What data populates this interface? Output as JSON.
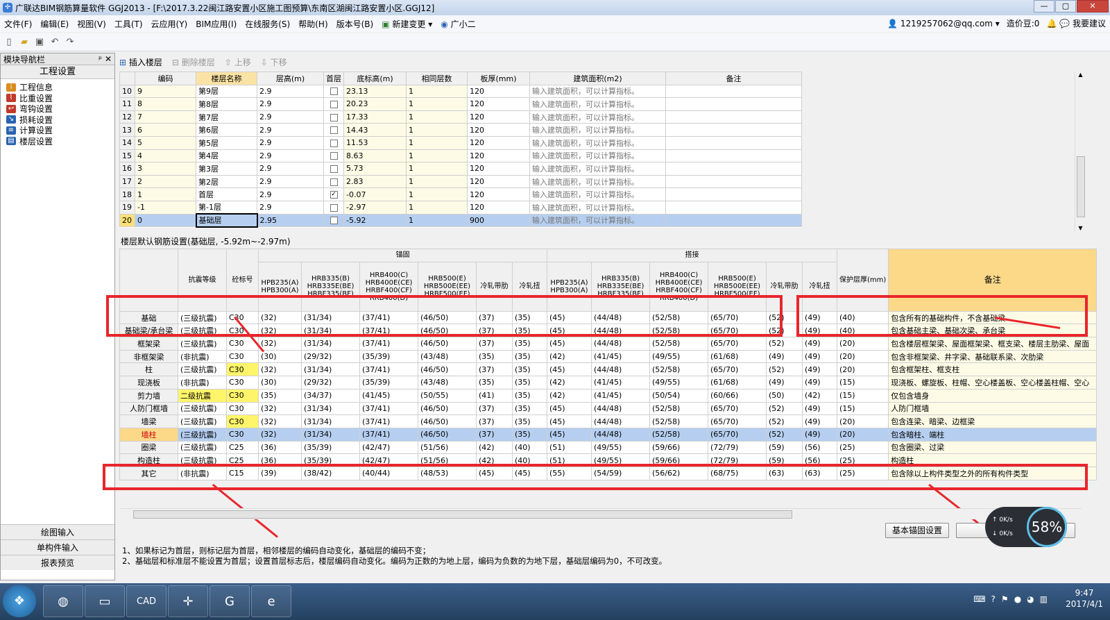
{
  "window": {
    "title": "广联达BIM钢筋算量软件 GGJ2013 - [F:\\2017.3.22闽江路安置小区施工图预算\\东南区湖闽江路安置小区.GGJ12]",
    "app_icon": "app-logo-icon",
    "buttons": {
      "minimize": "—",
      "restore": "▢",
      "close": "✕"
    }
  },
  "menu": {
    "items": [
      "文件(F)",
      "编辑(E)",
      "视图(V)",
      "工具(T)",
      "云应用(Y)",
      "BIM应用(I)",
      "在线服务(S)",
      "帮助(H)",
      "版本号(B)",
      "新建变更",
      "广小二"
    ],
    "account": "1219257062@qq.com",
    "price_beans": "造价豆:0",
    "suggest": "我要建议"
  },
  "nav": {
    "title": "模块导航栏",
    "pin": "ᵖ",
    "close": "✕",
    "section": "工程设置",
    "items": [
      {
        "label": "工程信息",
        "icon": "project-info-icon",
        "color": "#d98c1f"
      },
      {
        "label": "比重设置",
        "icon": "weight-setting-icon",
        "color": "#c0392b"
      },
      {
        "label": "弯钩设置",
        "icon": "hook-setting-icon",
        "color": "#c0392b"
      },
      {
        "label": "损耗设置",
        "icon": "loss-setting-icon",
        "color": "#2a63b0"
      },
      {
        "label": "计算设置",
        "icon": "calc-setting-icon",
        "color": "#2a63b0"
      },
      {
        "label": "楼层设置",
        "icon": "floor-setting-icon",
        "color": "#2a63b0"
      }
    ],
    "bottom": [
      "绘图输入",
      "单构件输入",
      "报表预览"
    ]
  },
  "floor_toolbar": {
    "insert": "插入楼层",
    "delete": "删除楼层",
    "up": "上移",
    "down": "下移"
  },
  "floor_table": {
    "headers": [
      "",
      "编码",
      "楼层名称",
      "层高(m)",
      "首层",
      "底标高(m)",
      "相同层数",
      "板厚(mm)",
      "建筑面积(m2)",
      "备注"
    ],
    "rows": [
      {
        "idx": "10",
        "code": "9",
        "name": "第9层",
        "height": "2.9",
        "first": false,
        "elev": "23.13",
        "same": "1",
        "thick": "120",
        "area": "输入建筑面积，可以计算指标。"
      },
      {
        "idx": "11",
        "code": "8",
        "name": "第8层",
        "height": "2.9",
        "first": false,
        "elev": "20.23",
        "same": "1",
        "thick": "120",
        "area": "输入建筑面积，可以计算指标。"
      },
      {
        "idx": "12",
        "code": "7",
        "name": "第7层",
        "height": "2.9",
        "first": false,
        "elev": "17.33",
        "same": "1",
        "thick": "120",
        "area": "输入建筑面积，可以计算指标。"
      },
      {
        "idx": "13",
        "code": "6",
        "name": "第6层",
        "height": "2.9",
        "first": false,
        "elev": "14.43",
        "same": "1",
        "thick": "120",
        "area": "输入建筑面积，可以计算指标。"
      },
      {
        "idx": "14",
        "code": "5",
        "name": "第5层",
        "height": "2.9",
        "first": false,
        "elev": "11.53",
        "same": "1",
        "thick": "120",
        "area": "输入建筑面积，可以计算指标。"
      },
      {
        "idx": "15",
        "code": "4",
        "name": "第4层",
        "height": "2.9",
        "first": false,
        "elev": "8.63",
        "same": "1",
        "thick": "120",
        "area": "输入建筑面积，可以计算指标。"
      },
      {
        "idx": "16",
        "code": "3",
        "name": "第3层",
        "height": "2.9",
        "first": false,
        "elev": "5.73",
        "same": "1",
        "thick": "120",
        "area": "输入建筑面积，可以计算指标。"
      },
      {
        "idx": "17",
        "code": "2",
        "name": "第2层",
        "height": "2.9",
        "first": false,
        "elev": "2.83",
        "same": "1",
        "thick": "120",
        "area": "输入建筑面积，可以计算指标。"
      },
      {
        "idx": "18",
        "code": "1",
        "name": "首层",
        "height": "2.9",
        "first": true,
        "elev": "-0.07",
        "same": "1",
        "thick": "120",
        "area": "输入建筑面积，可以计算指标。"
      },
      {
        "idx": "19",
        "code": "-1",
        "name": "第-1层",
        "height": "2.9",
        "first": false,
        "elev": "-2.97",
        "same": "1",
        "thick": "120",
        "area": "输入建筑面积，可以计算指标。"
      },
      {
        "idx": "20",
        "code": "0",
        "name": "基础层",
        "height": "2.95",
        "first": false,
        "elev": "-5.92",
        "same": "1",
        "thick": "900",
        "area": "输入建筑面积，可以计算指标。",
        "selected": true
      }
    ]
  },
  "rebar_settings": {
    "title": "楼层默认钢筋设置(基础层, -5.92m~-2.97m)",
    "group_anchor": "锚固",
    "group_lap": "搭接",
    "headers": {
      "seismic": "抗震等级",
      "concrete": "砼标号",
      "hpb": "HPB235(A) HPB300(A)",
      "hrb335": "HRB335(B) HRB335E(BE) HRBF335(BF)",
      "hrb400": "HRB400(C) HRB400E(CE) HRBF400(CF) RRB400(D)",
      "hrb500": "HRB500(E) HRB500E(EE) HRBF500(EF)",
      "cold_ribbed": "冷轧带肋",
      "cold_twisted": "冷轧扭",
      "cover": "保护层厚(mm)",
      "note": "备注"
    },
    "rows": [
      {
        "name": "基础",
        "seismic": "(三级抗震)",
        "concrete": "C30",
        "a1": "(32)",
        "a2": "(31/34)",
        "a3": "(37/41)",
        "a4": "(46/50)",
        "a5": "(37)",
        "a6": "(35)",
        "l1": "(45)",
        "l2": "(44/48)",
        "l3": "(52/58)",
        "l4": "(65/70)",
        "l5": "(52)",
        "l6": "(49)",
        "cover": "(40)",
        "note": "包含所有的基础构件，不含基础梁"
      },
      {
        "name": "基础梁/承台梁",
        "seismic": "(三级抗震)",
        "concrete": "C30",
        "a1": "(32)",
        "a2": "(31/34)",
        "a3": "(37/41)",
        "a4": "(46/50)",
        "a5": "(37)",
        "a6": "(35)",
        "l1": "(45)",
        "l2": "(44/48)",
        "l3": "(52/58)",
        "l4": "(65/70)",
        "l5": "(52)",
        "l6": "(49)",
        "cover": "(40)",
        "note": "包含基础主梁、基础次梁、承台梁"
      },
      {
        "name": "框架梁",
        "seismic": "(三级抗震)",
        "concrete": "C30",
        "a1": "(32)",
        "a2": "(31/34)",
        "a3": "(37/41)",
        "a4": "(46/50)",
        "a5": "(37)",
        "a6": "(35)",
        "l1": "(45)",
        "l2": "(44/48)",
        "l3": "(52/58)",
        "l4": "(65/70)",
        "l5": "(52)",
        "l6": "(49)",
        "cover": "(20)",
        "note": "包含楼层框架梁、屋面框架梁、框支梁、楼层主肋梁、屋面"
      },
      {
        "name": "非框架梁",
        "seismic": "(非抗震)",
        "concrete": "C30",
        "a1": "(30)",
        "a2": "(29/32)",
        "a3": "(35/39)",
        "a4": "(43/48)",
        "a5": "(35)",
        "a6": "(35)",
        "l1": "(42)",
        "l2": "(41/45)",
        "l3": "(49/55)",
        "l4": "(61/68)",
        "l5": "(49)",
        "l6": "(49)",
        "cover": "(20)",
        "note": "包含非框架梁、井字梁、基础联系梁、次肋梁"
      },
      {
        "name": "柱",
        "seismic": "(三级抗震)",
        "concrete": "C30",
        "hlC": true,
        "a1": "(32)",
        "a2": "(31/34)",
        "a3": "(37/41)",
        "a4": "(46/50)",
        "a5": "(37)",
        "a6": "(35)",
        "l1": "(45)",
        "l2": "(44/48)",
        "l3": "(52/58)",
        "l4": "(65/70)",
        "l5": "(52)",
        "l6": "(49)",
        "cover": "(20)",
        "note": "包含框架柱、框支柱"
      },
      {
        "name": "现浇板",
        "seismic": "(非抗震)",
        "concrete": "C30",
        "a1": "(30)",
        "a2": "(29/32)",
        "a3": "(35/39)",
        "a4": "(43/48)",
        "a5": "(35)",
        "a6": "(35)",
        "l1": "(42)",
        "l2": "(41/45)",
        "l3": "(49/55)",
        "l4": "(61/68)",
        "l5": "(49)",
        "l6": "(49)",
        "cover": "(15)",
        "note": "现浇板、螺旋板、柱帽、空心楼盖板、空心楼盖柱帽、空心"
      },
      {
        "name": "剪力墙",
        "seismic": "二级抗震",
        "hlS": true,
        "concrete": "C30",
        "hlC": true,
        "a1": "(35)",
        "a2": "(34/37)",
        "a3": "(41/45)",
        "a4": "(50/55)",
        "a5": "(41)",
        "a6": "(35)",
        "l1": "(42)",
        "l2": "(41/45)",
        "l3": "(50/54)",
        "l4": "(60/66)",
        "l5": "(50)",
        "l6": "(42)",
        "cover": "(15)",
        "note": "仅包含墙身"
      },
      {
        "name": "人防门框墙",
        "seismic": "(三级抗震)",
        "concrete": "C30",
        "a1": "(32)",
        "a2": "(31/34)",
        "a3": "(37/41)",
        "a4": "(46/50)",
        "a5": "(37)",
        "a6": "(35)",
        "l1": "(45)",
        "l2": "(44/48)",
        "l3": "(52/58)",
        "l4": "(65/70)",
        "l5": "(52)",
        "l6": "(49)",
        "cover": "(15)",
        "note": "人防门框墙"
      },
      {
        "name": "墙梁",
        "seismic": "(三级抗震)",
        "concrete": "C30",
        "hlC": true,
        "a1": "(32)",
        "a2": "(31/34)",
        "a3": "(37/41)",
        "a4": "(46/50)",
        "a5": "(37)",
        "a6": "(35)",
        "l1": "(45)",
        "l2": "(44/48)",
        "l3": "(52/58)",
        "l4": "(65/70)",
        "l5": "(52)",
        "l6": "(49)",
        "cover": "(20)",
        "note": "包含连梁、暗梁、边框梁"
      },
      {
        "name": "墙柱",
        "seismic": "(三级抗震)",
        "concrete": "C30",
        "a1": "(32)",
        "a2": "(31/34)",
        "a3": "(37/41)",
        "a4": "(46/50)",
        "a5": "(37)",
        "a6": "(35)",
        "l1": "(45)",
        "l2": "(44/48)",
        "l3": "(52/58)",
        "l4": "(65/70)",
        "l5": "(52)",
        "l6": "(49)",
        "cover": "(20)",
        "note": "包含暗柱、端柱",
        "selected": true
      },
      {
        "name": "圈梁",
        "seismic": "(三级抗震)",
        "concrete": "C25",
        "a1": "(36)",
        "a2": "(35/39)",
        "a3": "(42/47)",
        "a4": "(51/56)",
        "a5": "(42)",
        "a6": "(40)",
        "l1": "(51)",
        "l2": "(49/55)",
        "l3": "(59/66)",
        "l4": "(72/79)",
        "l5": "(59)",
        "l6": "(56)",
        "cover": "(25)",
        "note": "包含圈梁、过梁"
      },
      {
        "name": "构造柱",
        "seismic": "(三级抗震)",
        "concrete": "C25",
        "a1": "(36)",
        "a2": "(35/39)",
        "a3": "(42/47)",
        "a4": "(51/56)",
        "a5": "(42)",
        "a6": "(40)",
        "l1": "(51)",
        "l2": "(49/55)",
        "l3": "(59/66)",
        "l4": "(72/79)",
        "l5": "(59)",
        "l6": "(56)",
        "cover": "(25)",
        "note": "构造柱"
      },
      {
        "name": "其它",
        "seismic": "(非抗震)",
        "concrete": "C15",
        "a1": "(39)",
        "a2": "(38/42)",
        "a3": "(40/44)",
        "a4": "(48/53)",
        "a5": "(45)",
        "a6": "(45)",
        "l1": "(55)",
        "l2": "(54/59)",
        "l3": "(56/62)",
        "l4": "(68/75)",
        "l5": "(63)",
        "l6": "(63)",
        "cover": "(25)",
        "note": "包含除以上构件类型之外的所有构件类型"
      }
    ]
  },
  "buttons": {
    "basic_anchor": "基本锚固设置",
    "copy_to": "复制到其他楼层"
  },
  "footnotes": [
    "1、如果标记为首层，则标记层为首层，相邻楼层的编码自动变化，基础层的编码不变；",
    "2、基础层和标准层不能设置为首层；设置首层标志后，楼层编码自动变化。编码为正数的为地上层，编码为负数的为地下层，基础层编码为0，不可改变。"
  ],
  "speed_widget": {
    "up": "0K/s",
    "down": "0K/s",
    "percent": "58%"
  },
  "taskbar": {
    "start": "❖",
    "apps": [
      "chrome-icon",
      "folder-icon",
      "cad-icon",
      "gld-icon",
      "browser-icon",
      "ie-icon"
    ],
    "cad_label": "CAD",
    "time": "9:47",
    "date": "2017/4/1"
  },
  "colors": {
    "accent_red": "#e8262b",
    "selection": "#b6cff0",
    "header_highlight": "#fbd989"
  }
}
